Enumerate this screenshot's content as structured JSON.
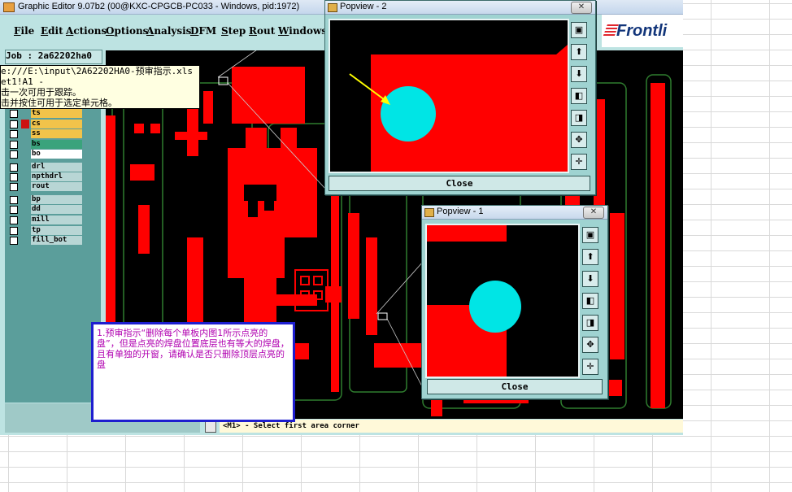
{
  "app": {
    "title": "Graphic Editor 9.07b2 (00@KXC-CPGCB-PC033 - Windows, pid:1972)",
    "menus": [
      "File",
      "Edit",
      "Actions",
      "Options",
      "Analysis",
      "DFM",
      "Step",
      "Rout",
      "Windows"
    ],
    "logo_text": "Frontli",
    "job_label": "Job : 2a62202ha0",
    "command_prompt": "<M1> - Select first area corner"
  },
  "tooltip": {
    "lines": [
      "e:///E:\\input\\2A62202HA0-预审指示.xls -",
      "et1!A1 -",
      "击一次可用于跟踪。",
      "击并按住可用于选定单元格。"
    ]
  },
  "layers": [
    {
      "name": "ts",
      "color": "#f2c34a"
    },
    {
      "name": "cs",
      "color": "#f2c34a",
      "active": true
    },
    {
      "name": "ss",
      "color": "#f2c34a"
    },
    {
      "name": "bs",
      "color": "#3aa37c"
    },
    {
      "name": "bo",
      "color": "#ffffff"
    },
    {
      "name": "drl",
      "color": "#b8d6d5"
    },
    {
      "name": "npthdrl",
      "color": "#b8d6d5"
    },
    {
      "name": "rout",
      "color": "#b8d6d5"
    },
    {
      "name": "bp",
      "color": "#b8d6d5"
    },
    {
      "name": "dd",
      "color": "#b8d6d5"
    },
    {
      "name": "mill",
      "color": "#b8d6d5"
    },
    {
      "name": "tp",
      "color": "#b8d6d5"
    },
    {
      "name": "fill_bot",
      "color": "#b8d6d5"
    }
  ],
  "popview2": {
    "title": "Popview - 2",
    "close_label": "Close"
  },
  "popview1": {
    "title": "Popview - 1",
    "close_label": "Close"
  },
  "note": {
    "text": "1.预审指示“删除每个单板内图1所示点亮的盘”，但是点亮的焊盘位置底层也有等大的焊盘，且有单独的开窗，请确认是否只删除顶层点亮的盘"
  },
  "colors": {
    "copper": "#ff0000",
    "pad": "#00e5e5",
    "highlight": "#ffff00"
  }
}
